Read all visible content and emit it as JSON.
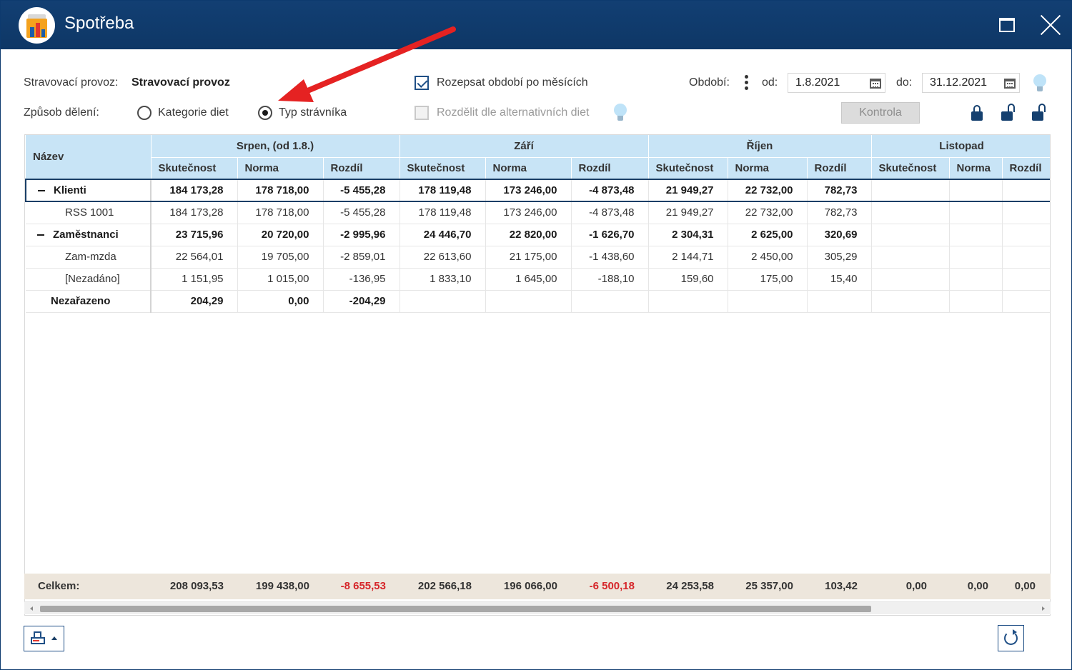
{
  "window": {
    "title": "Spotřeba",
    "icon": "canteen-bag-chart-icon",
    "controls": [
      "maximize-icon",
      "close-icon"
    ]
  },
  "filters": {
    "provoz_label": "Stravovací provoz:",
    "provoz_value": "Stravovací provoz",
    "deleni_label": "Způsob dělení:",
    "radio_kategorie": "Kategorie diet",
    "radio_typ": "Typ strávníka",
    "selected_radio": "Typ strávníka",
    "check_rozepsat": "Rozepsat období po měsících",
    "check_rozepsat_checked": true,
    "check_rozdelit": "Rozdělit dle alternativních diet",
    "check_rozdelit_checked": false,
    "obdobi_label": "Období:",
    "od_label": "od:",
    "od_value": "1.8.2021",
    "do_label": "do:",
    "do_value": "31.12.2021",
    "kontrola_label": "Kontrola"
  },
  "grid": {
    "name_header": "Název",
    "groups": [
      "Srpen, (od 1.8.)",
      "Září",
      "Říjen",
      "Listopad"
    ],
    "subheaders": [
      "Skutečnost",
      "Norma",
      "Rozdíl"
    ],
    "rows": [
      {
        "name": "Klienti",
        "level": 0,
        "group": true,
        "values": [
          "184 173,28",
          "178 718,00",
          "-5 455,28",
          "178 119,48",
          "173 246,00",
          "-4 873,48",
          "21 949,27",
          "22 732,00",
          "782,73"
        ]
      },
      {
        "name": "RSS 1001",
        "level": 1,
        "group": false,
        "values": [
          "184 173,28",
          "178 718,00",
          "-5 455,28",
          "178 119,48",
          "173 246,00",
          "-4 873,48",
          "21 949,27",
          "22 732,00",
          "782,73"
        ]
      },
      {
        "name": "Zaměstnanci",
        "level": 0,
        "group": true,
        "values": [
          "23 715,96",
          "20 720,00",
          "-2 995,96",
          "24 446,70",
          "22 820,00",
          "-1 626,70",
          "2 304,31",
          "2 625,00",
          "320,69"
        ]
      },
      {
        "name": "Zam-mzda",
        "level": 1,
        "group": false,
        "values": [
          "22 564,01",
          "19 705,00",
          "-2 859,01",
          "22 613,60",
          "21 175,00",
          "-1 438,60",
          "2 144,71",
          "2 450,00",
          "305,29"
        ]
      },
      {
        "name": "[Nezadáno]",
        "level": 1,
        "group": false,
        "values": [
          "1 151,95",
          "1 015,00",
          "-136,95",
          "1 833,10",
          "1 645,00",
          "-188,10",
          "159,60",
          "175,00",
          "15,40"
        ]
      },
      {
        "name": "Nezařazeno",
        "level": 0,
        "group": true,
        "values": [
          "204,29",
          "0,00",
          "-204,29",
          "",
          "",
          "",
          "",
          "",
          ""
        ]
      }
    ]
  },
  "totals": {
    "label": "Celkem:",
    "values": [
      "208 093,53",
      "199 438,00",
      "-8 655,53",
      "202 566,18",
      "196 066,00",
      "-6 500,18",
      "24 253,58",
      "25 357,00",
      "103,42",
      "0,00",
      "0,00",
      "0,00"
    ],
    "negative_color": "#d6262a"
  },
  "colors": {
    "titlebar": "#0e3766",
    "header_bg": "#c8e4f6",
    "totals_bg": "#ede6dc",
    "arrow": "#e52222"
  }
}
